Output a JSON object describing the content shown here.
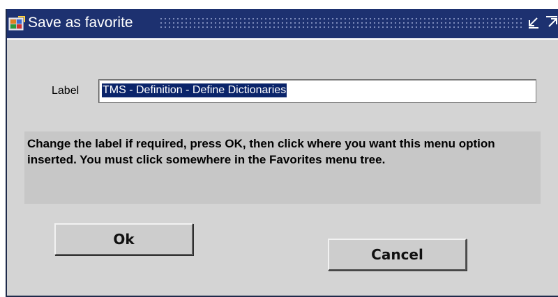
{
  "window": {
    "title": "Save as favorite",
    "icons": {
      "app": "app-icon",
      "minimize": "minimize-icon",
      "maximize": "maximize-icon"
    }
  },
  "form": {
    "label_caption": "Label",
    "label_value": "TMS - Definition - Define Dictionaries"
  },
  "hint": {
    "text": "Change the label if required, press OK, then click where you want this menu option inserted. You must click somewhere in the Favorites menu tree."
  },
  "buttons": {
    "ok_label": "Ok",
    "cancel_label": "Cancel"
  },
  "colors": {
    "titlebar": "#1d3170",
    "selection": "#0a246a",
    "dialog_bg": "#d4d4d4",
    "hint_bg": "#c7c7c7"
  }
}
